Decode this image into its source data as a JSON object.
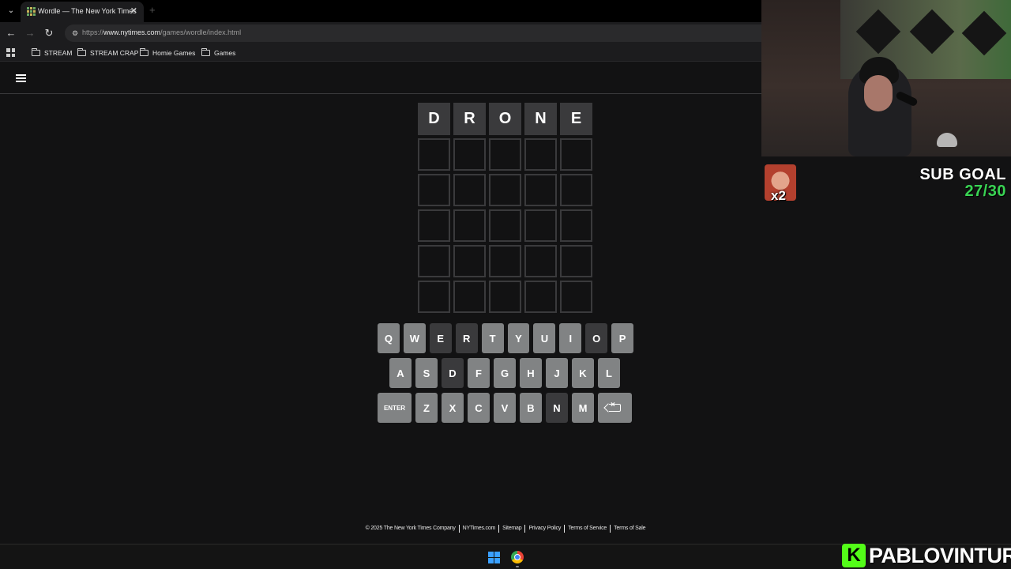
{
  "browser": {
    "tab": {
      "title": "Wordle — The New York Times",
      "favicon": "wordle-icon"
    },
    "omnibox": {
      "url_prefix": "https://",
      "url_host": "www.nytimes.com",
      "url_path": "/games/wordle/index.html"
    },
    "bookmarks": [
      {
        "label": "STREAM"
      },
      {
        "label": "STREAM CRAP"
      },
      {
        "label": "Homie Games"
      },
      {
        "label": "Games"
      }
    ]
  },
  "game": {
    "board": [
      [
        "D",
        "R",
        "O",
        "N",
        "E"
      ],
      [
        "",
        "",
        "",
        "",
        ""
      ],
      [
        "",
        "",
        "",
        "",
        ""
      ],
      [
        "",
        "",
        "",
        "",
        ""
      ],
      [
        "",
        "",
        "",
        "",
        ""
      ],
      [
        "",
        "",
        "",
        "",
        ""
      ]
    ],
    "board_states": [
      [
        "absent",
        "absent",
        "absent",
        "absent",
        "absent"
      ],
      [
        "empty",
        "empty",
        "empty",
        "empty",
        "empty"
      ],
      [
        "empty",
        "empty",
        "empty",
        "empty",
        "empty"
      ],
      [
        "empty",
        "empty",
        "empty",
        "empty",
        "empty"
      ],
      [
        "empty",
        "empty",
        "empty",
        "empty",
        "empty"
      ],
      [
        "empty",
        "empty",
        "empty",
        "empty",
        "empty"
      ]
    ],
    "keyboard": {
      "row1": [
        "Q",
        "W",
        "E",
        "R",
        "T",
        "Y",
        "U",
        "I",
        "O",
        "P"
      ],
      "row2": [
        "A",
        "S",
        "D",
        "F",
        "G",
        "H",
        "J",
        "K",
        "L"
      ],
      "row3": [
        "Z",
        "X",
        "C",
        "V",
        "B",
        "N",
        "M"
      ],
      "enter_label": "ENTER",
      "absent_keys": [
        "E",
        "R",
        "O",
        "D",
        "N"
      ]
    },
    "colors": {
      "absent": "#3a3a3c",
      "key": "#818384",
      "background": "#121213"
    }
  },
  "footer": {
    "links": [
      "© 2025 The New York Times Company",
      "NYTimes.com",
      "Sitemap",
      "Privacy Policy",
      "Terms of Service",
      "Terms of Sale"
    ]
  },
  "overlay": {
    "emote_multiplier": "x2",
    "sub_goal_label": "SUB GOAL",
    "sub_goal_count": "27/30",
    "kick_logo_letter": "K",
    "channel_name": "PABLOVINTURA",
    "accent_color": "#39d353"
  }
}
